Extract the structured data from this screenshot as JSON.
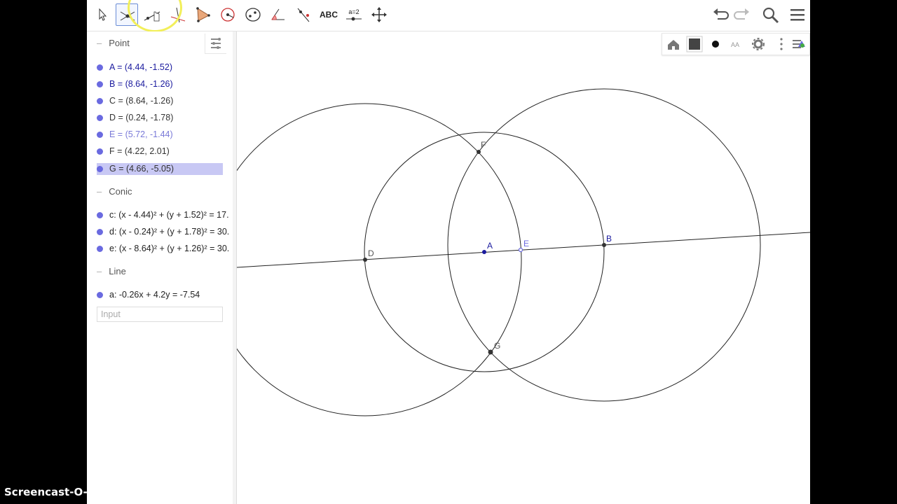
{
  "toolbar": {
    "text_tool_label": "ABC",
    "slider_tool_label": "a=2"
  },
  "algebra": {
    "menu_icon": "algebra-menu-icon",
    "categories": {
      "point": "Point",
      "conic": "Conic",
      "line": "Line"
    },
    "points": [
      {
        "text": "A = (4.44, -1.52)",
        "color": "#1a1a9e"
      },
      {
        "text": "B = (8.64, -1.26)",
        "color": "#1a1a9e"
      },
      {
        "text": "C = (8.64, -1.26)",
        "color": "#333333"
      },
      {
        "text": "D = (0.24, -1.78)",
        "color": "#333333"
      },
      {
        "text": "E = (5.72, -1.44)",
        "color": "#7a7ad8"
      },
      {
        "text": "F = (4.22, 2.01)",
        "color": "#333333"
      },
      {
        "text": "G = (4.66, -5.05)",
        "color": "#333333"
      }
    ],
    "conics": [
      {
        "text": "c: (x - 4.44)² + (y + 1.52)² = 17."
      },
      {
        "text": "d: (x - 0.24)² + (y + 1.78)² = 30."
      },
      {
        "text": "e: (x - 8.64)² + (y + 1.26)² = 30."
      }
    ],
    "lines": [
      {
        "text": "a: -0.26x + 4.2y = -7.54"
      }
    ],
    "input_placeholder": "Input"
  },
  "graphics": {
    "labels": {
      "A": "A",
      "B": "B",
      "D": "D",
      "E": "E",
      "F": "F",
      "G": "G"
    }
  },
  "colors": {
    "accent": "#6a6ae0",
    "selected_row": "#c8c8f4",
    "highlight_circle": "#f2ef5a"
  },
  "watermark": "Screencast-O-Matic.com"
}
